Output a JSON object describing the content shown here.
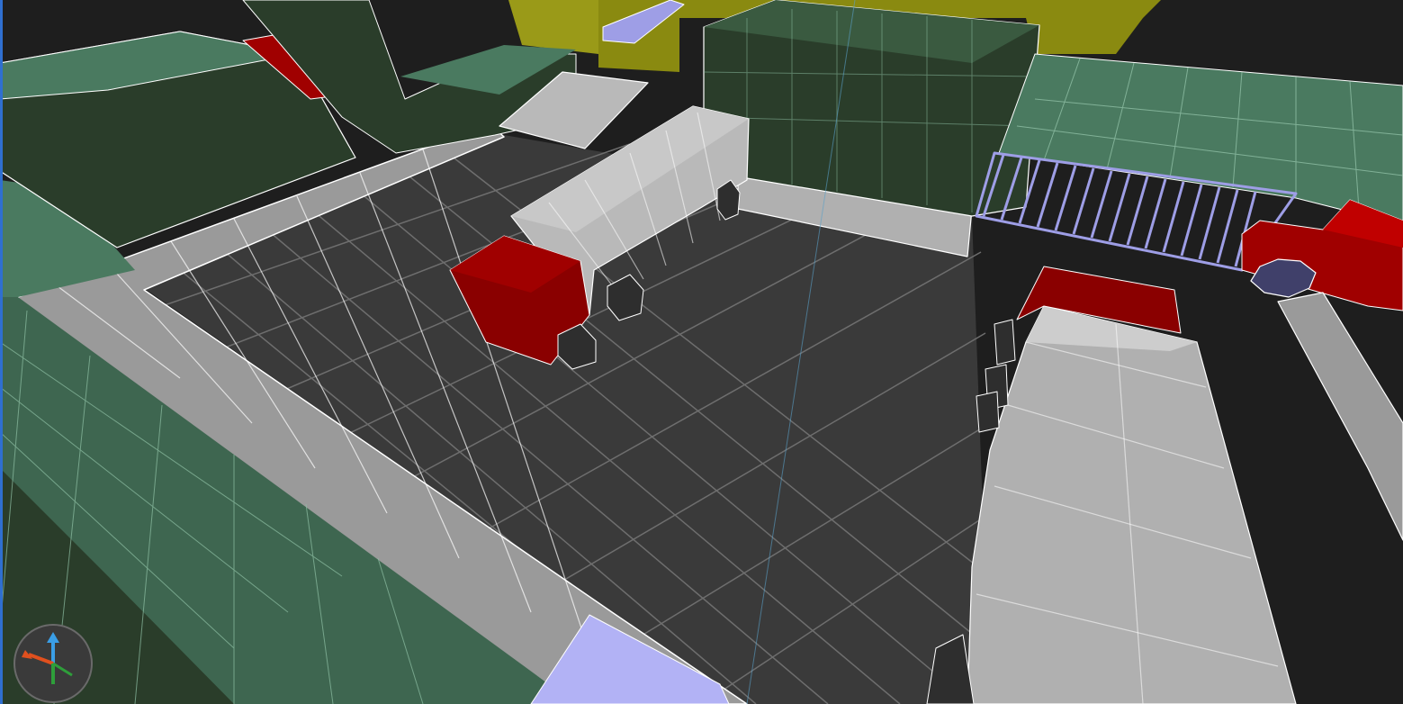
{
  "app": {
    "view": "perspective-3d-viewport",
    "render_mode": "wireframe-on-shaded"
  },
  "colors": {
    "background": "#1e1e1e",
    "floor": "#3a3a3a",
    "floor_grid": "#6e6e6e",
    "walkway": "#9a9a9a",
    "walkway_light": "#b9b9b9",
    "wall_green_dark": "#2a3d2a",
    "wall_green_mid": "#3e6650",
    "wall_green_light": "#4a7a60",
    "red_block": "#8a0000",
    "red_block_top": "#a00000",
    "yellow_wall": "#8a8a10",
    "lavender": "#9e9ee6",
    "gate": "#8a8ad0",
    "wire": "#ffffff"
  },
  "objects": [
    {
      "name": "floor-plane",
      "color": "floor"
    },
    {
      "name": "walkway",
      "color": "walkway"
    },
    {
      "name": "green-wall-block",
      "color": "wall_green_dark"
    },
    {
      "name": "red-crate",
      "color": "red_block"
    },
    {
      "name": "gray-block",
      "color": "walkway_light"
    },
    {
      "name": "yellow-wall",
      "color": "yellow_wall"
    },
    {
      "name": "railing-gate",
      "color": "gate"
    },
    {
      "name": "octagon-marker",
      "color": "lavender"
    }
  ],
  "gizmo": {
    "x_axis_color": "#e0501e",
    "y_axis_color": "#2e9e3a",
    "z_axis_color": "#3a9ee6",
    "icon": "axis-gizmo-icon"
  }
}
